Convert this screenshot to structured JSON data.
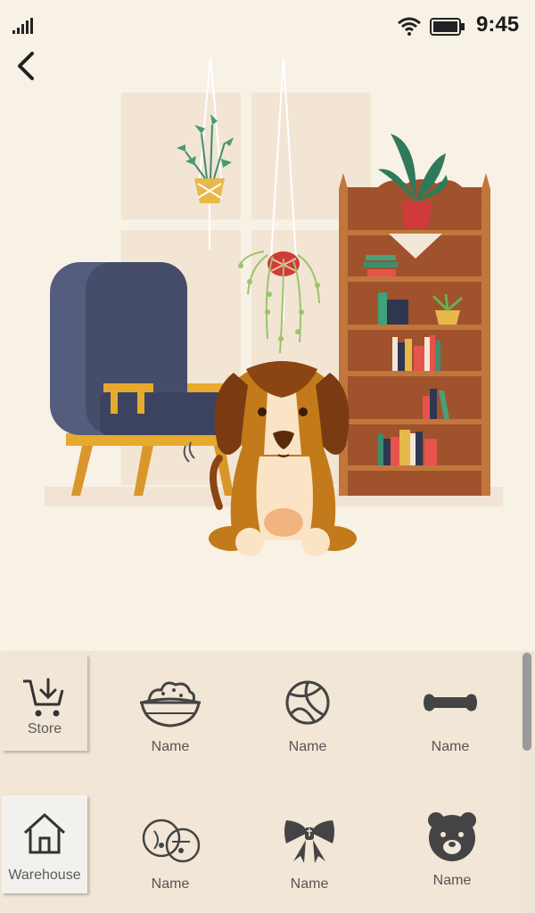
{
  "status_bar": {
    "time": "9:45",
    "signal_icon": "cellular-signal-icon",
    "wifi_icon": "wifi-icon",
    "battery_icon": "battery-icon"
  },
  "nav": {
    "back_icon": "chevron-left-icon"
  },
  "side_tabs": [
    {
      "label": "Store",
      "icon": "shopping-cart-download-icon"
    },
    {
      "label": "Warehouse",
      "icon": "house-icon"
    }
  ],
  "items": [
    {
      "name": "Name",
      "icon": "food-bowl-icon"
    },
    {
      "name": "Name",
      "icon": "ball-icon"
    },
    {
      "name": "Name",
      "icon": "bone-icon"
    },
    {
      "name": "Name",
      "icon": "bells-icon"
    },
    {
      "name": "Name",
      "icon": "bow-tie-icon"
    },
    {
      "name": "Name",
      "icon": "bear-head-icon"
    }
  ],
  "colors": {
    "background": "#f8f1e5",
    "panel": "#f2e6d6",
    "shelf": "#a0522d",
    "chair": "#464d6b",
    "dog_brown": "#8b4513"
  }
}
